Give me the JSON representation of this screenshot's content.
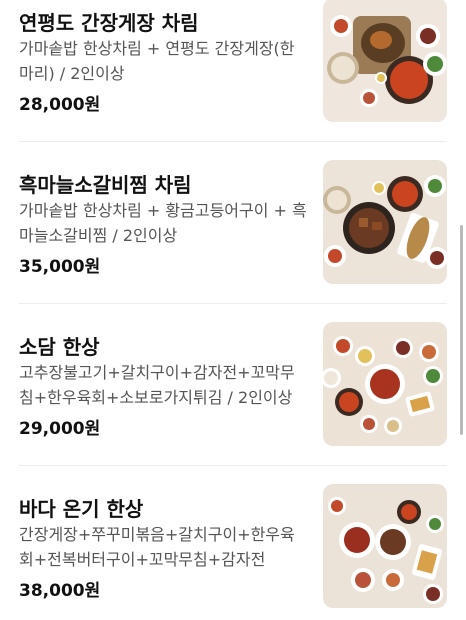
{
  "menu": {
    "items": [
      {
        "title": "연평도 간장게장 차림",
        "desc": "가마솥밥 한상차림 + 연평도 간장게장(한마리) / 2인이상",
        "price": "28,000원",
        "image": "crab-table-photo"
      },
      {
        "title": "흑마늘소갈비찜 차림",
        "desc": "가마솥밥 한상차림 + 황금고등어구이 + 흑마늘소갈비찜 / 2인이상",
        "price": "35,000원",
        "image": "galbi-table-photo"
      },
      {
        "title": "소담 한상",
        "desc": "고추장불고기+갈치구이+감자전+꼬막무침+한우육회+소보로가지튀김 / 2인이상",
        "price": "29,000원",
        "image": "sodam-table-photo"
      },
      {
        "title": "바다 온기 한상",
        "desc": "간장게장+쭈꾸미볶음+갈치구이+한우육회+전복버터구이+꼬막무침+감자전",
        "price": "38,000원",
        "image": "sea-table-photo"
      }
    ]
  },
  "colors": {
    "title": "#111111",
    "desc": "#555555",
    "divider": "#ececec",
    "photo_bg": "#efe7dd"
  }
}
